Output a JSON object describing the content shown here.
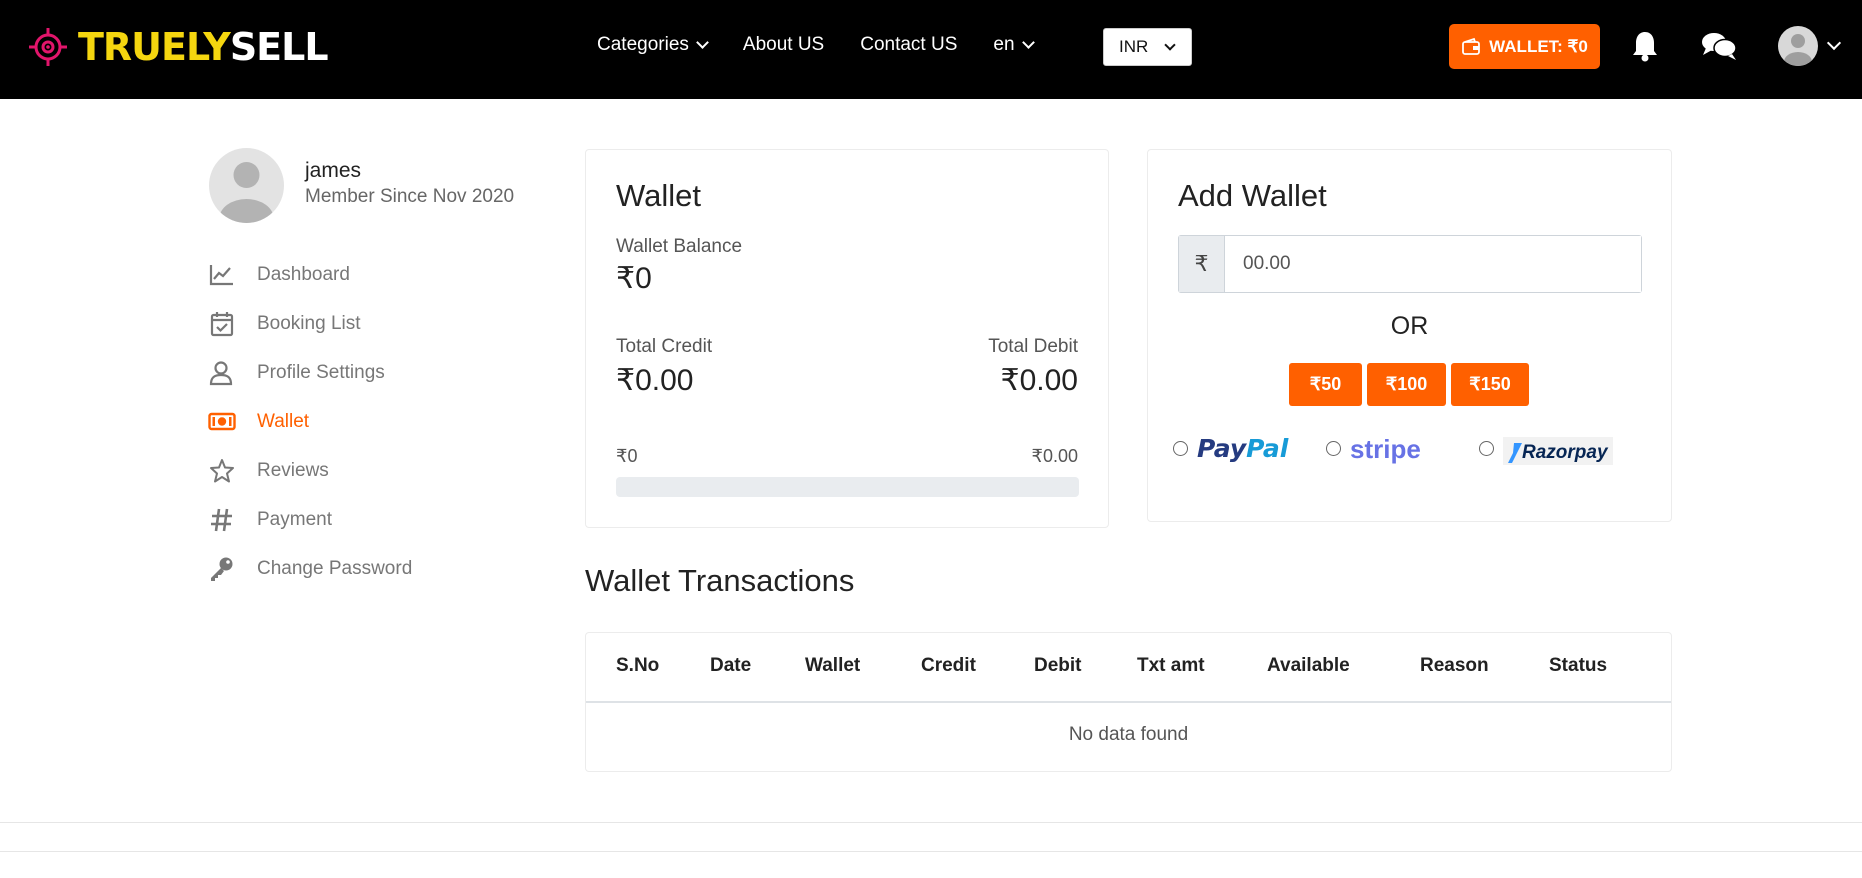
{
  "header": {
    "logo_part1": "TRUELY",
    "logo_part2": "SELL",
    "nav": {
      "categories": "Categories",
      "about": "About US",
      "contact": "Contact US",
      "language": "en"
    },
    "currency_selected": "INR",
    "wallet_button": "WALLET: ₹0",
    "brand_color": "#ff6000"
  },
  "profile": {
    "name": "james",
    "member_since": "Member Since Nov 2020"
  },
  "sidebar": {
    "items": [
      {
        "label": "Dashboard",
        "icon": "chart-icon"
      },
      {
        "label": "Booking List",
        "icon": "calendar-check-icon"
      },
      {
        "label": "Profile Settings",
        "icon": "user-icon"
      },
      {
        "label": "Wallet",
        "icon": "money-icon",
        "active": true
      },
      {
        "label": "Reviews",
        "icon": "star-icon"
      },
      {
        "label": "Payment",
        "icon": "hash-icon"
      },
      {
        "label": "Change Password",
        "icon": "key-icon"
      }
    ]
  },
  "wallet": {
    "title": "Wallet",
    "balance_label": "Wallet Balance",
    "balance_value": "₹0",
    "credit_label": "Total Credit",
    "credit_value": "₹0.00",
    "debit_label": "Total Debit",
    "debit_value": "₹0.00",
    "progress_min": "₹0",
    "progress_max": "₹0.00",
    "progress_fraction": 0
  },
  "add_wallet": {
    "title": "Add Wallet",
    "currency_symbol": "₹",
    "amount_placeholder": "00.00",
    "or_text": "OR",
    "quick_amounts": [
      "₹50",
      "₹100",
      "₹150"
    ],
    "gateways": {
      "paypal_a": "Pay",
      "paypal_b": "Pal",
      "stripe": "stripe",
      "razorpay": "Razorpay"
    }
  },
  "transactions": {
    "title": "Wallet Transactions",
    "columns": [
      "S.No",
      "Date",
      "Wallet",
      "Credit",
      "Debit",
      "Txt amt",
      "Available",
      "Reason",
      "Status"
    ],
    "empty_text": "No data found"
  }
}
